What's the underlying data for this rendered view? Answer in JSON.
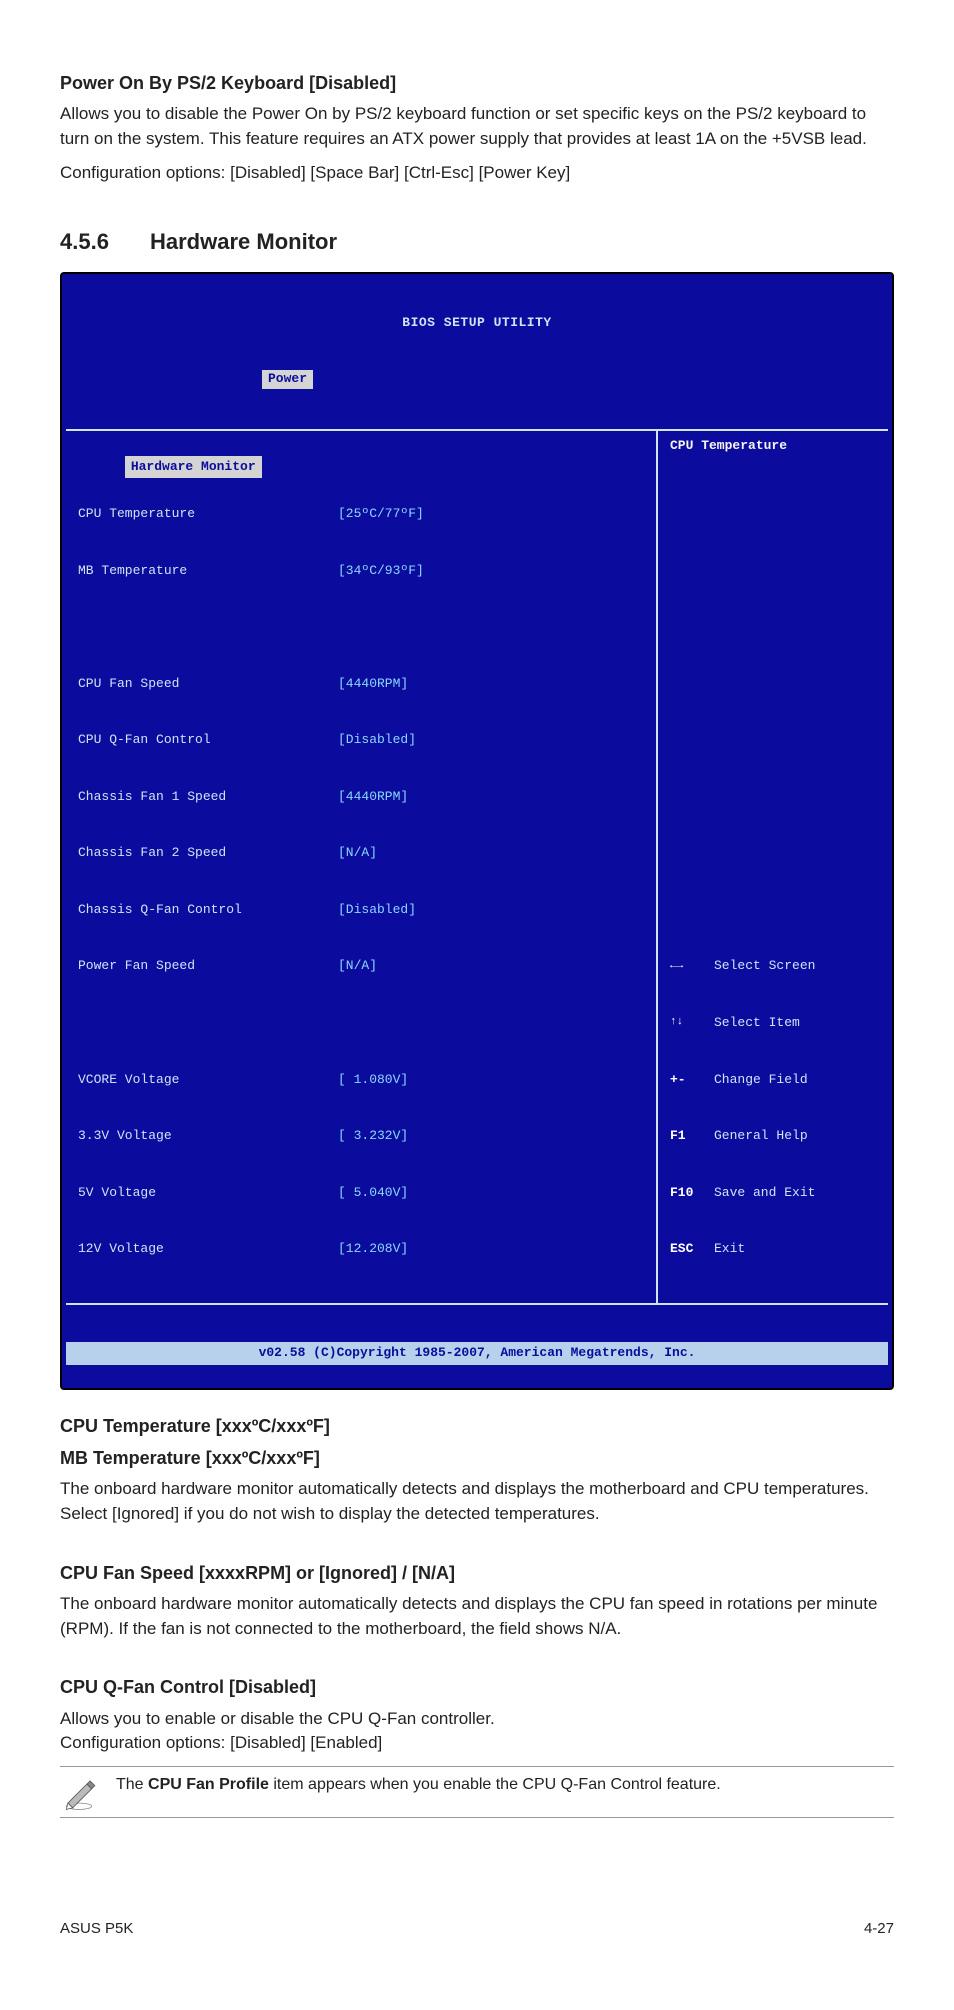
{
  "section1": {
    "heading": "Power On By PS/2 Keyboard [Disabled]",
    "para1": "Allows you to disable the Power On by PS/2 keyboard function or set specific keys on the PS/2 keyboard to turn on the system. This feature requires an ATX power supply that provides at least 1A on the +5VSB lead.",
    "para2": "Configuration options: [Disabled] [Space Bar] [Ctrl-Esc] [Power Key]"
  },
  "section2": {
    "num": "4.5.6",
    "title": "Hardware Monitor"
  },
  "bios": {
    "header": "BIOS SETUP UTILITY",
    "tab": "Power",
    "left_title": "Hardware Monitor",
    "rows": [
      {
        "label": "CPU Temperature",
        "value": "[25ºC/77ºF]"
      },
      {
        "label": "MB Temperature",
        "value": "[34ºC/93ºF]"
      },
      {
        "label": "",
        "value": ""
      },
      {
        "label": "CPU Fan Speed",
        "value": "[4440RPM]"
      },
      {
        "label": "CPU Q-Fan Control",
        "value": "[Disabled]"
      },
      {
        "label": "Chassis Fan 1 Speed",
        "value": "[4440RPM]"
      },
      {
        "label": "Chassis Fan 2 Speed",
        "value": "[N/A]"
      },
      {
        "label": "Chassis Q-Fan Control",
        "value": "[Disabled]"
      },
      {
        "label": "Power Fan Speed",
        "value": "[N/A]"
      },
      {
        "label": "",
        "value": ""
      },
      {
        "label": "VCORE Voltage",
        "value": "[ 1.080V]"
      },
      {
        "label": "3.3V Voltage",
        "value": "[ 3.232V]"
      },
      {
        "label": "5V Voltage",
        "value": "[ 5.040V]"
      },
      {
        "label": "12V Voltage",
        "value": "[12.208V]"
      }
    ],
    "help_title": "CPU Temperature",
    "nav": [
      {
        "key": "←→",
        "text": "Select Screen"
      },
      {
        "key": "↑↓",
        "text": "Select Item"
      },
      {
        "key": "+-",
        "text": "Change Field"
      },
      {
        "key": "F1",
        "text": "General Help"
      },
      {
        "key": "F10",
        "text": "Save and Exit"
      },
      {
        "key": "ESC",
        "text": "Exit"
      }
    ],
    "footer": "v02.58 (C)Copyright 1985-2007, American Megatrends, Inc."
  },
  "section3": {
    "heading1": "CPU Temperature [xxxºC/xxxºF]",
    "heading2": "MB Temperature [xxxºC/xxxºF]",
    "para": "The onboard hardware monitor automatically detects and displays the motherboard and CPU temperatures. Select [Ignored] if you do not wish to display the detected temperatures."
  },
  "section4": {
    "heading": "CPU Fan Speed [xxxxRPM] or [Ignored] / [N/A]",
    "para": "The onboard hardware monitor automatically detects and displays the CPU fan speed in rotations per minute (RPM). If the fan is not connected to the motherboard, the field shows N/A."
  },
  "section5": {
    "heading": "CPU Q-Fan Control [Disabled]",
    "para1": "Allows you to enable or disable the CPU Q-Fan controller.",
    "para2": "Configuration options: [Disabled] [Enabled]"
  },
  "note": {
    "text_before": "The ",
    "bold": "CPU Fan Profile",
    "text_after": " item appears when you enable the CPU Q-Fan Control feature."
  },
  "footer": {
    "left": "ASUS P5K",
    "right": "4-27"
  }
}
